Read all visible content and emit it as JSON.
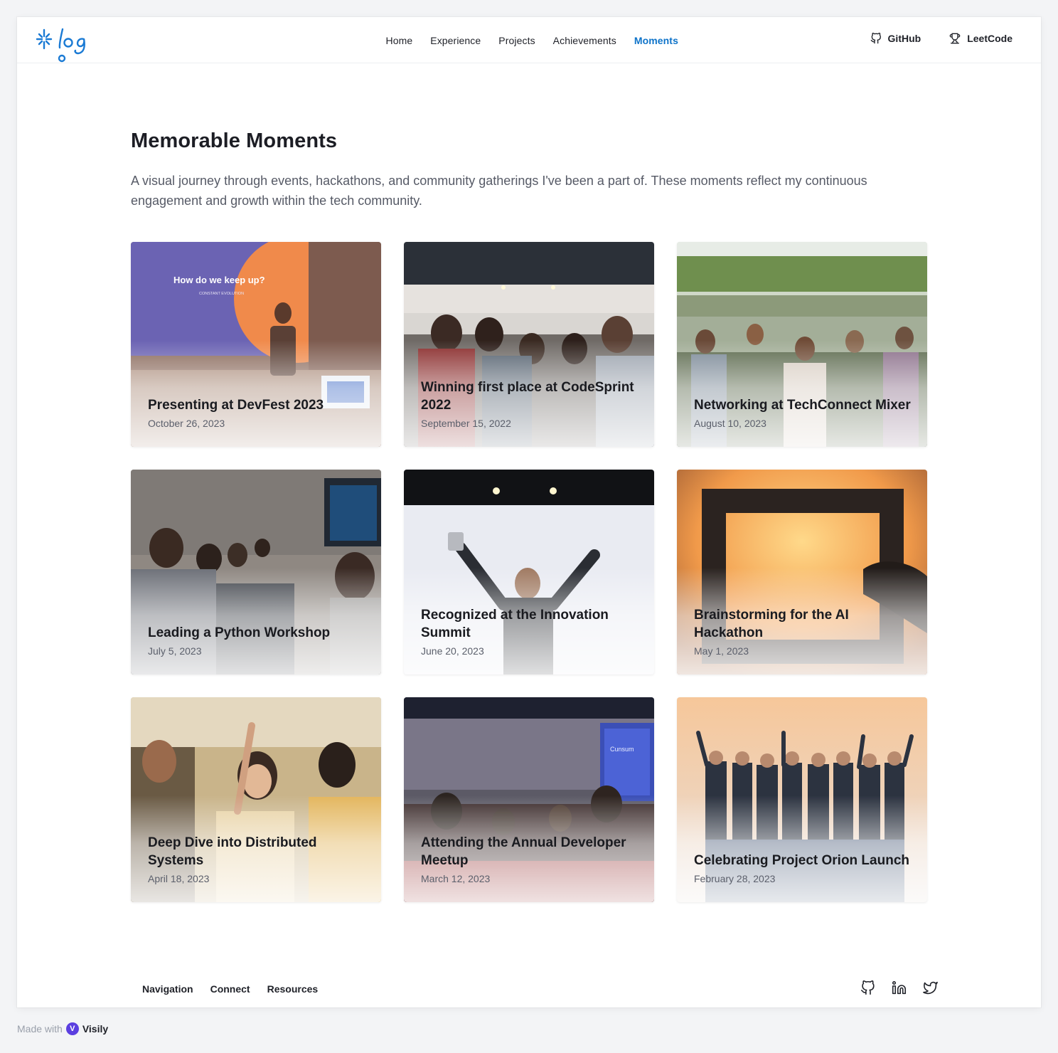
{
  "header": {
    "logo_text": "log",
    "nav": [
      "Home",
      "Experience",
      "Projects",
      "Achievements",
      "Moments"
    ],
    "active_nav": "Moments",
    "github_label": "GitHub",
    "leetcode_label": "LeetCode"
  },
  "main": {
    "title": "Memorable Moments",
    "intro": "A visual journey through events, hackathons, and community gatherings I've been a part of. These moments reflect my continuous engagement and growth within the tech community.",
    "moments": [
      {
        "title": "Presenting at DevFest 2023",
        "date": "October 26, 2023",
        "slide_text": "How do we keep up?",
        "slide_sub": "CONSTANT EVOLUTION"
      },
      {
        "title": "Winning first place at CodeSprint 2022",
        "date": "September 15, 2022"
      },
      {
        "title": "Networking at TechConnect Mixer",
        "date": "August 10, 2023"
      },
      {
        "title": "Leading a Python Workshop",
        "date": "July 5, 2023"
      },
      {
        "title": "Recognized at the Innovation Summit",
        "date": "June 20, 2023"
      },
      {
        "title": "Brainstorming for the AI Hackathon",
        "date": "May 1, 2023"
      },
      {
        "title": "Deep Dive into Distributed Systems",
        "date": "April 18, 2023"
      },
      {
        "title": "Attending the Annual Developer Meetup",
        "date": "March 12, 2023",
        "screen_text": "Cunsum"
      },
      {
        "title": "Celebrating Project Orion Launch",
        "date": "February 28, 2023"
      }
    ]
  },
  "footer": {
    "links": [
      "Navigation",
      "Connect",
      "Resources"
    ],
    "social_icons": [
      "github-icon",
      "linkedin-icon",
      "twitter-icon"
    ]
  },
  "made_with": {
    "prefix": "Made with",
    "brand": "Visily"
  },
  "colors": {
    "accent": "#0e73c9",
    "text": "#1f2128",
    "muted": "#565a66"
  }
}
